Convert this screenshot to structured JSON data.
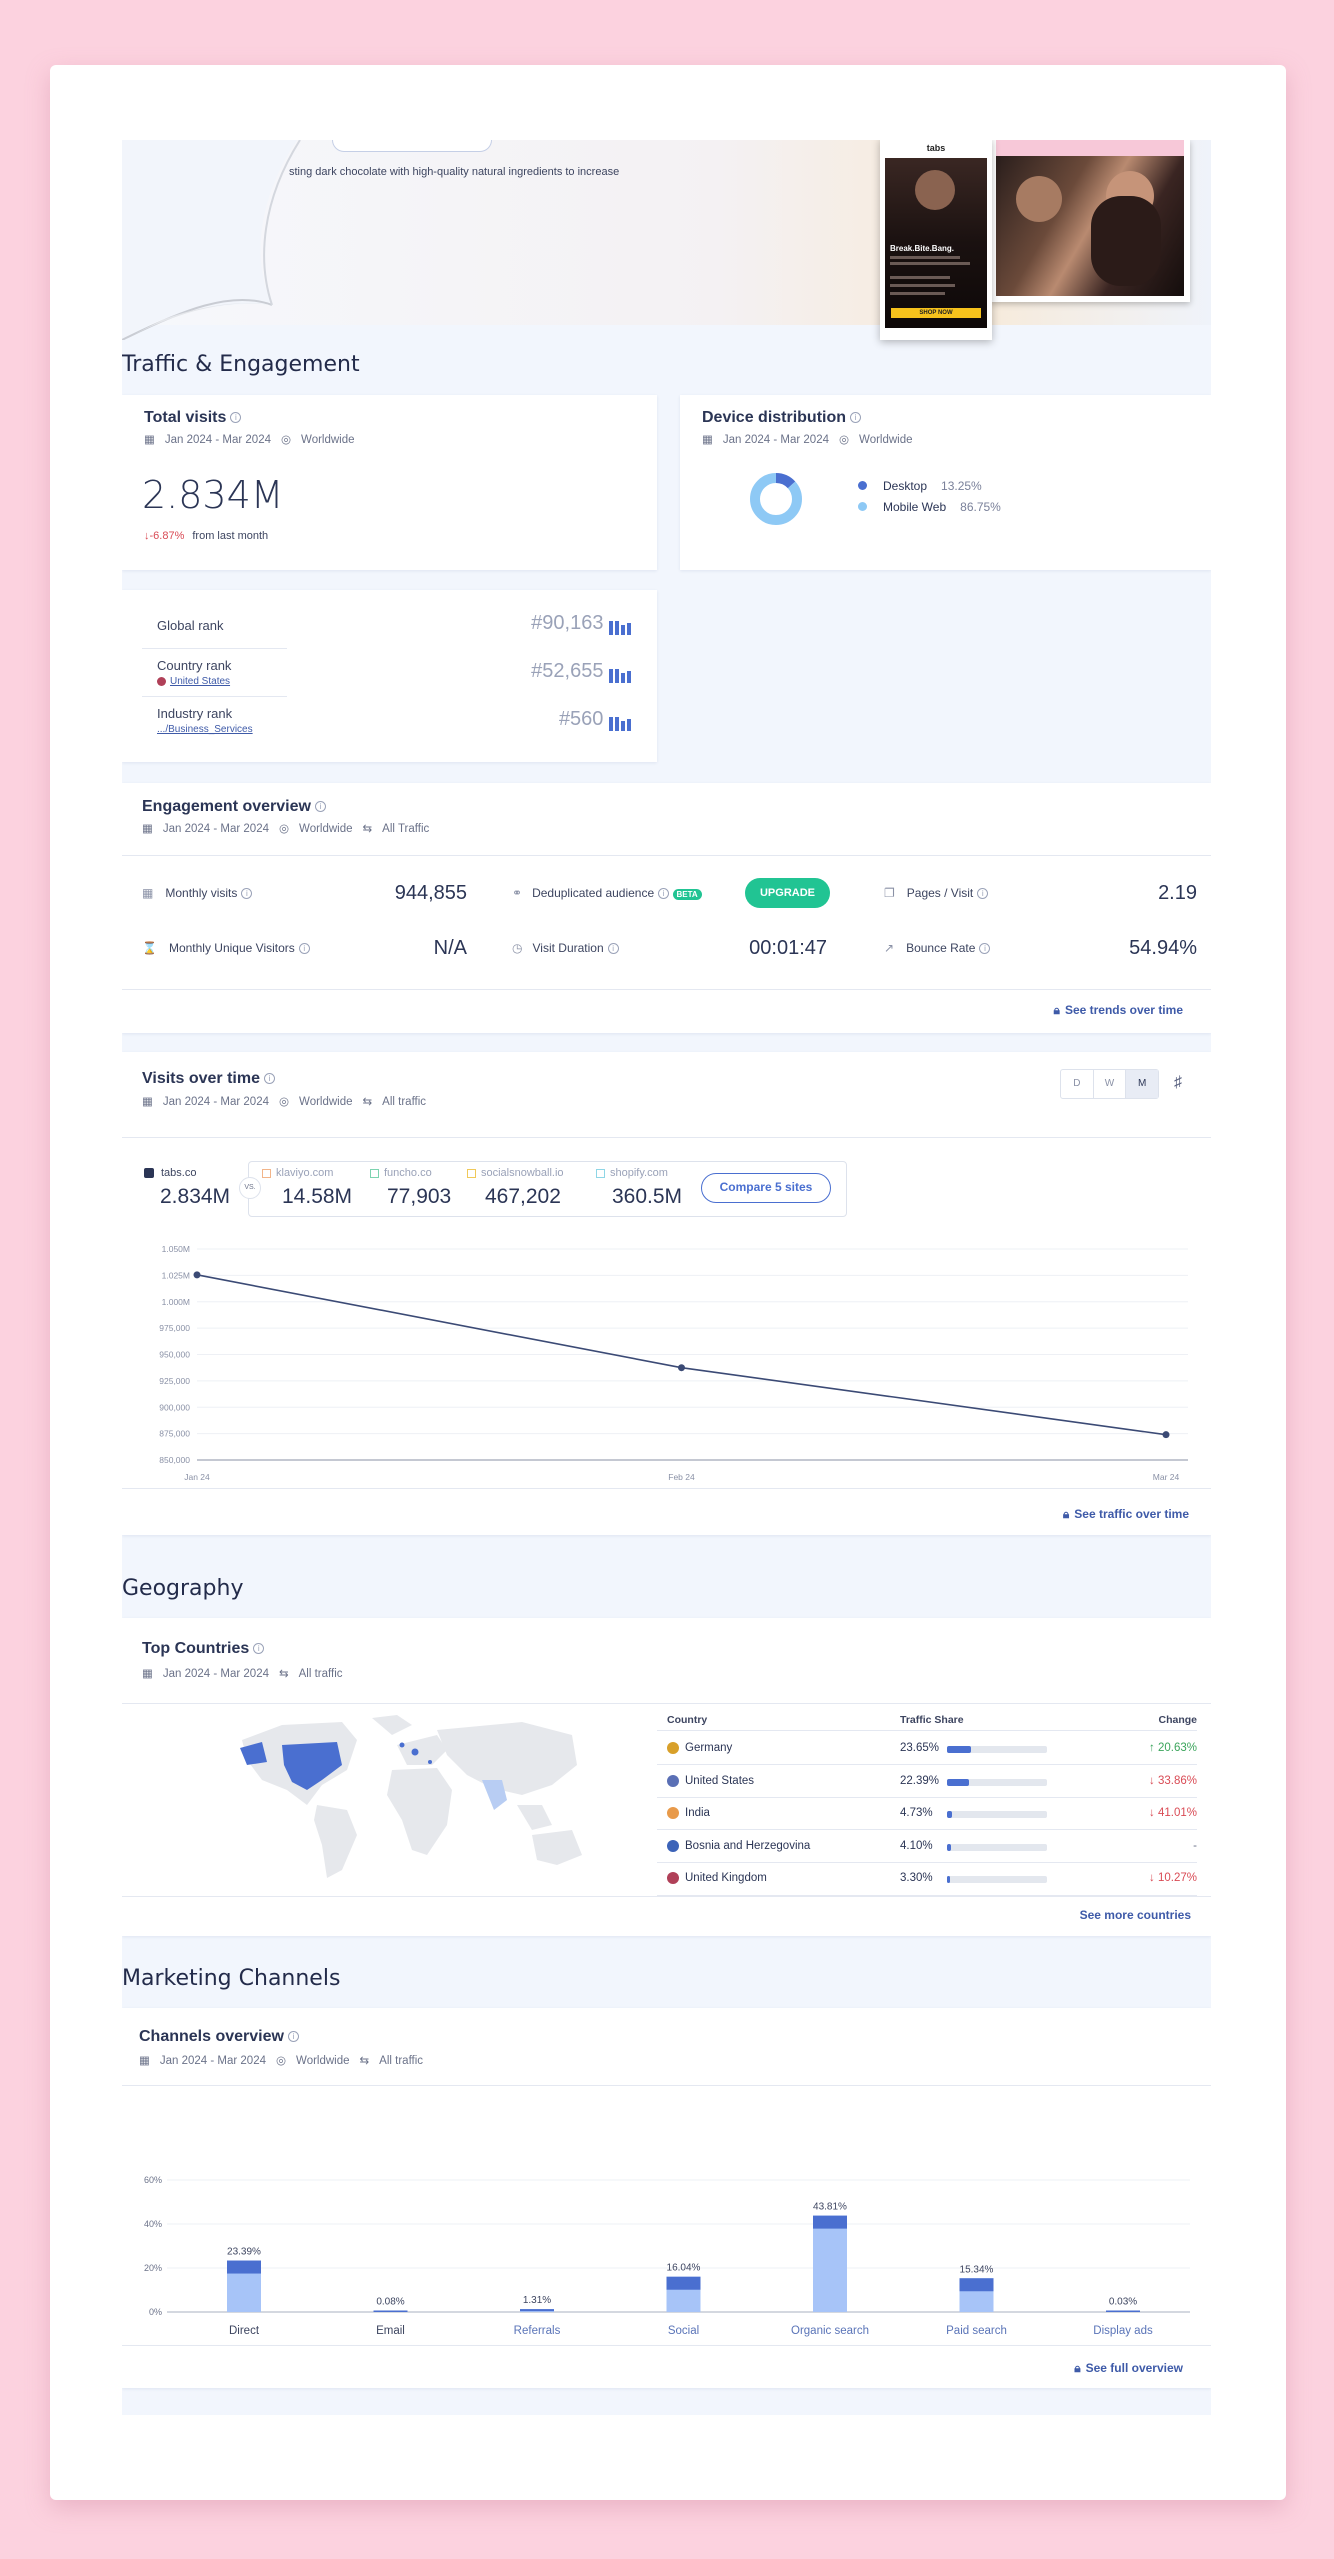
{
  "hero": {
    "description": "sting dark chocolate with high-quality natural ingredients to increase",
    "phone_brand": "tabs",
    "phone_headline": "Break.Bite.Bang.",
    "phone_cta": "SHOP NOW"
  },
  "sections": {
    "traffic": "Traffic & Engagement",
    "geography": "Geography",
    "marketing": "Marketing Channels"
  },
  "total_visits": {
    "title": "Total visits",
    "date": "Jan 2024 - Mar 2024",
    "region": "Worldwide",
    "value": "2.834M",
    "change": "-6.87%",
    "change_suffix": "from last month"
  },
  "device": {
    "title": "Device distribution",
    "date": "Jan 2024 - Mar 2024",
    "region": "Worldwide",
    "items": [
      {
        "label": "Desktop",
        "value": "13.25%",
        "share": 0.1325,
        "color": "#4a6fd0"
      },
      {
        "label": "Mobile Web",
        "value": "86.75%",
        "share": 0.8675,
        "color": "#8ec9f5"
      }
    ]
  },
  "ranks": [
    {
      "label": "Global rank",
      "sub": "",
      "value": "#90,163"
    },
    {
      "label": "Country rank",
      "sub": "United States",
      "value": "#52,655"
    },
    {
      "label": "Industry rank",
      "sub": ".../Business_Services",
      "value": "#560"
    }
  ],
  "engagement": {
    "title": "Engagement overview",
    "date": "Jan 2024 - Mar 2024",
    "region": "Worldwide",
    "traffic": "All Traffic",
    "monthly_visits_label": "Monthly visits",
    "monthly_visits": "944,855",
    "dedup_label": "Deduplicated audience",
    "beta": "BETA",
    "upgrade": "UPGRADE",
    "pages_label": "Pages / Visit",
    "pages": "2.19",
    "unique_label": "Monthly Unique Visitors",
    "unique": "N/A",
    "duration_label": "Visit Duration",
    "duration": "00:01:47",
    "bounce_label": "Bounce Rate",
    "bounce": "54.94%",
    "link": "See trends over time"
  },
  "visits": {
    "title": "Visits over time",
    "date": "Jan 2024 - Mar 2024",
    "region": "Worldwide",
    "traffic": "All traffic",
    "granularity": [
      "D",
      "W",
      "M"
    ],
    "selected_granularity": "M",
    "site": "tabs.co",
    "site_value": "2.834M",
    "vs": "VS.",
    "competitors": [
      {
        "name": "klaviyo.com",
        "value": "14.58M",
        "color": "#f2b58a"
      },
      {
        "name": "funcho.co",
        "value": "77,903",
        "color": "#7dd3b0"
      },
      {
        "name": "socialsnowball.io",
        "value": "467,202",
        "color": "#f0c95a"
      },
      {
        "name": "shopify.com",
        "value": "360.5M",
        "color": "#8fd6e6"
      }
    ],
    "compare_button": "Compare 5 sites",
    "link": "See traffic over time"
  },
  "chart_data": [
    {
      "type": "line",
      "x": [
        "Jan 24",
        "Feb 24",
        "Mar 24"
      ],
      "series": [
        {
          "name": "tabs.co",
          "values": [
            1025500,
            937500,
            874000
          ]
        }
      ],
      "ylim": [
        850000,
        1050000
      ],
      "yticks": [
        "850,000",
        "875,000",
        "900,000",
        "925,000",
        "950,000",
        "975,000",
        "1.000M",
        "1.025M",
        "1.050M"
      ],
      "ytick_values": [
        850000,
        875000,
        900000,
        925000,
        950000,
        975000,
        1000000,
        1025000,
        1050000
      ],
      "grid": true
    },
    {
      "type": "bar",
      "categories": [
        "Direct",
        "Email",
        "Referrals",
        "Social",
        "Organic search",
        "Paid search",
        "Display ads"
      ],
      "values": [
        23.39,
        0.08,
        1.31,
        16.04,
        43.81,
        15.34,
        0.03
      ],
      "labels": [
        "23.39%",
        "0.08%",
        "1.31%",
        "16.04%",
        "43.81%",
        "15.34%",
        "0.03%"
      ],
      "yticks": [
        "0%",
        "20%",
        "40%",
        "60%"
      ],
      "ytick_values": [
        0,
        20,
        40,
        60
      ],
      "ylim": [
        0,
        60
      ],
      "grid": true
    }
  ],
  "countries": {
    "title": "Top Countries",
    "date": "Jan 2024 - Mar 2024",
    "traffic": "All traffic",
    "headers": [
      "Country",
      "Traffic Share",
      "Change"
    ],
    "rows": [
      {
        "name": "Germany",
        "share": "23.65%",
        "share_num": 23.65,
        "change": "20.63%",
        "dir": "up",
        "flag": "#d8a02a"
      },
      {
        "name": "United States",
        "share": "22.39%",
        "share_num": 22.39,
        "change": "33.86%",
        "dir": "down",
        "flag": "#5a6fb5"
      },
      {
        "name": "India",
        "share": "4.73%",
        "share_num": 4.73,
        "change": "41.01%",
        "dir": "down",
        "flag": "#e89a4a"
      },
      {
        "name": "Bosnia and Herzegovina",
        "share": "4.10%",
        "share_num": 4.1,
        "change": "-",
        "dir": "none",
        "flag": "#3c63b8"
      },
      {
        "name": "United Kingdom",
        "share": "3.30%",
        "share_num": 3.3,
        "change": "10.27%",
        "dir": "down",
        "flag": "#b04058"
      }
    ],
    "link": "See more countries"
  },
  "channels": {
    "title": "Channels overview",
    "date": "Jan 2024 - Mar 2024",
    "region": "Worldwide",
    "traffic": "All traffic",
    "link": "See full overview"
  },
  "colors": {
    "accent": "#4a6fd0",
    "upgrade": "#21c493",
    "up": "#3ca55c",
    "down": "#d94b55",
    "background": "#fcd2df"
  }
}
